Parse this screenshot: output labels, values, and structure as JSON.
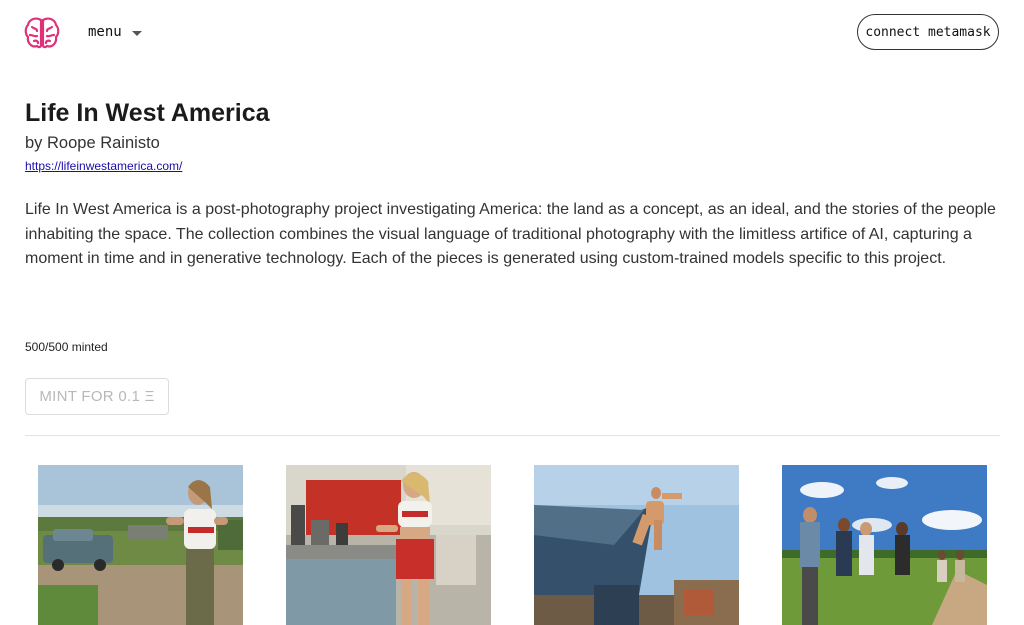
{
  "header": {
    "menu_label": "menu",
    "connect_label": "connect metamask",
    "logo_icon": "brain-icon",
    "logo_color": "#e0307a"
  },
  "project": {
    "title": "Life In West America",
    "author": "by Roope Rainisto",
    "url": "https://lifeinwestamerica.com/",
    "description": "Life In West America is a post-photography project investigating America: the land as a concept, as an ideal, and the stories of the people inhabiting the space. The collection combines the visual language of traditional photography with the limitless artifice of AI, capturing a moment in time and in generative technology. Each of the pieces is generated using custom-trained models specific to this project.",
    "minted": "500/500 minted",
    "mint_button": "MINT FOR 0.1 Ξ"
  },
  "gallery": [
    {
      "name": "gallery-image-1"
    },
    {
      "name": "gallery-image-2"
    },
    {
      "name": "gallery-image-3"
    },
    {
      "name": "gallery-image-4"
    }
  ]
}
